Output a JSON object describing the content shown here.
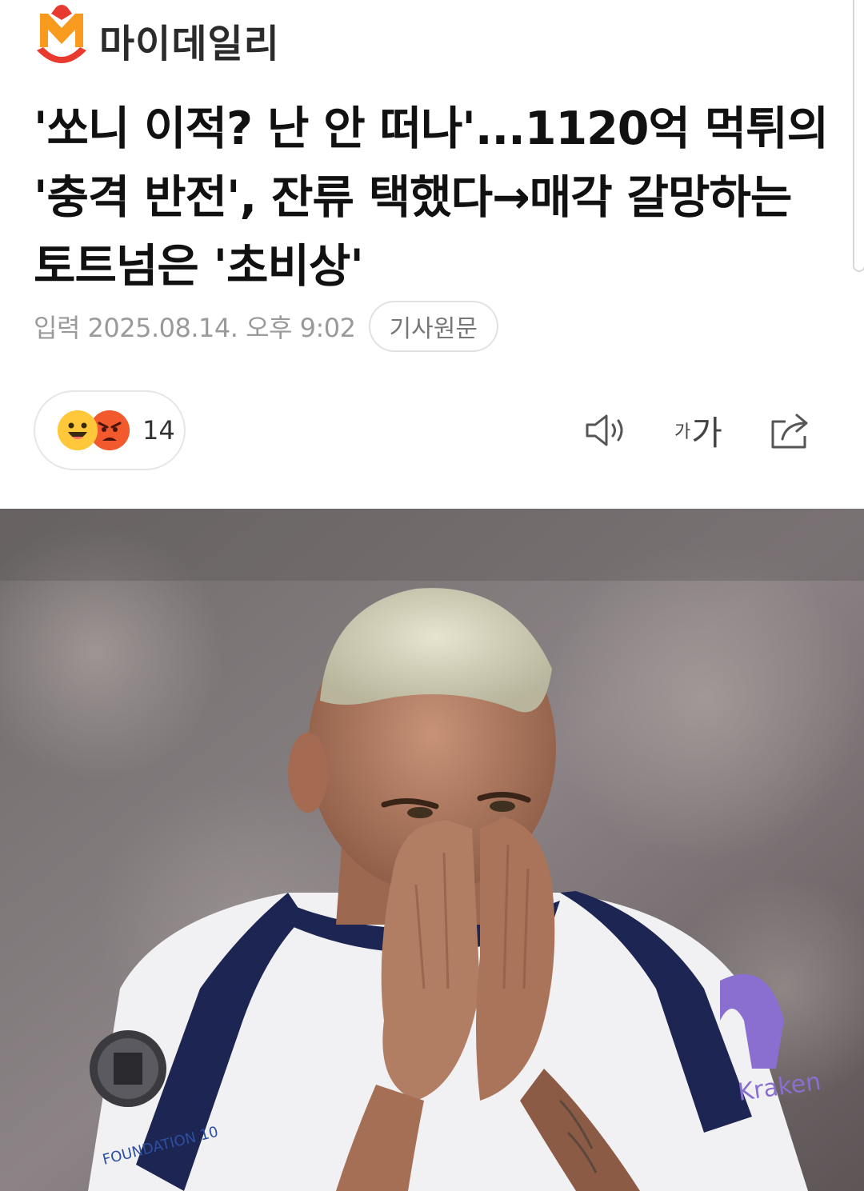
{
  "header": {
    "site_name": "마이데일리",
    "logo_icon": "mydaily-m-logo-icon",
    "brand_colors": {
      "red": "#e83a2f",
      "orange": "#f79a1e"
    }
  },
  "article": {
    "headline_lines": [
      "'쏘니 이적? 난 안 떠나'...1120억 먹튀의",
      "'충격 반전', 잔류 택했다→매각 갈망하는",
      "토트넘은 '초비상'"
    ],
    "published": "입력 2025.08.14. 오후 9:02",
    "original_link_label": "기사원문"
  },
  "reactions": {
    "icons": [
      "smile-emoji-icon",
      "angry-emoji-icon"
    ],
    "count": "14",
    "colors": {
      "smile": "#ffc83a",
      "angry": "#f25a2e"
    }
  },
  "toolbar": {
    "audio_icon": "speaker-icon",
    "font_small": "가",
    "font_big": "가",
    "share_icon": "share-icon"
  },
  "photo": {
    "subject_icon": "football-player-photo",
    "badge_text": "FOUNDATION 10",
    "sponsor_text": "Kraken"
  }
}
